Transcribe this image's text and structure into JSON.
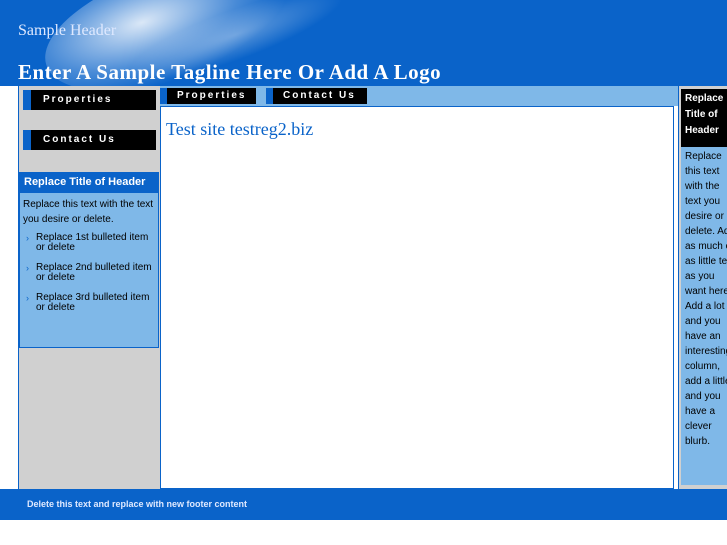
{
  "header": {
    "site_header": "Sample Header",
    "tagline": "Enter A Sample Tagline Here Or Add A Logo"
  },
  "top_nav": {
    "items": [
      {
        "label": "Properties"
      },
      {
        "label": "Contact Us"
      }
    ]
  },
  "left_nav": {
    "items": [
      {
        "label": "Properties"
      },
      {
        "label": "Contact Us"
      }
    ],
    "box": {
      "title": "Replace Title of Header",
      "body": "Replace this text with the text you desire or delete.",
      "bullets": [
        {
          "text": "Replace 1st bulleted item or delete"
        },
        {
          "text": "Replace 2nd bulleted item or delete"
        },
        {
          "text": "Replace 3rd bulleted item or delete"
        }
      ]
    }
  },
  "main": {
    "page_title": "Test site testreg2.biz"
  },
  "right_sidebar": {
    "title": "Replace Title of Header",
    "body": "Replace this text with the text you desire or delete. Add as much or as little text as you want here. Add a lot and you have an interesting column, add a little and you have a clever blurb."
  },
  "footer": {
    "text": "Delete this text and replace with new footer content"
  },
  "colors": {
    "brand_blue": "#0a63c9",
    "light_blue": "#7fb8e8",
    "gray": "#d0d0d0"
  }
}
